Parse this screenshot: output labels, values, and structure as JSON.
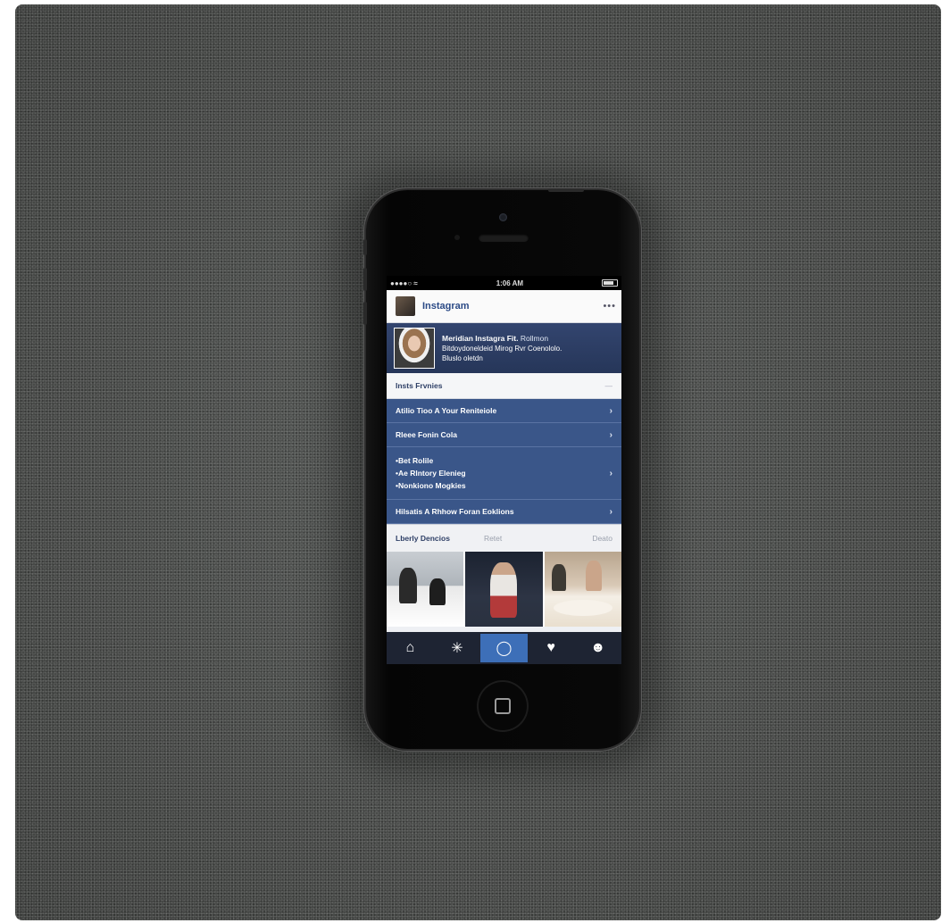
{
  "status": {
    "time": "1:06 AM",
    "carrier": ""
  },
  "app": {
    "title": "Instagram"
  },
  "profile": {
    "name": "Meridian Instagra Fit.",
    "handle": "Rollmon",
    "line2": "Bitdoydoneldeid Mirog Rvr Coenololo.",
    "line3": "Bluslo oletdn"
  },
  "section": {
    "title": "Insts Frvnies",
    "right": "—"
  },
  "menu": {
    "item1": "Atilio Tioo A Your Reniteiole",
    "item2": "Rleee Fonin Cola",
    "bullets": [
      "Bet Rolile",
      "Ae Rlntory Elenieg",
      "Nonkiono Mogkies"
    ],
    "item4": "Hilsatis A Rhhow Foran Eoklions"
  },
  "friends": {
    "label": "Lberly Dencios",
    "col2": "Retet",
    "col3": "Deato"
  },
  "icons": {
    "home": "home-icon",
    "explore": "explore-icon",
    "camera": "camera-icon",
    "activity": "activity-icon",
    "profile": "profile-icon",
    "chevron": "chevron-right-icon"
  },
  "colors": {
    "brand": "#3a5689",
    "tab_active": "#3d6fb8",
    "tabbar": "#1e2433"
  }
}
